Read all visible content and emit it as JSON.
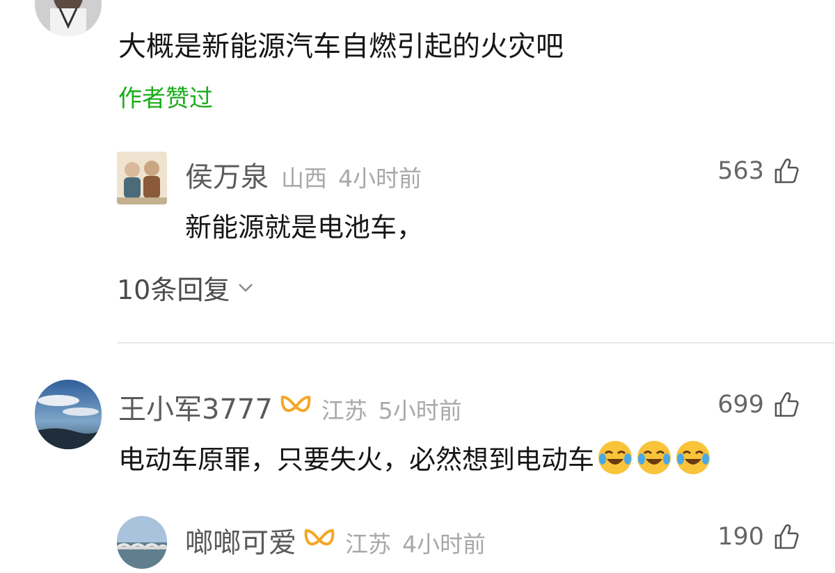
{
  "comments": [
    {
      "username": "",
      "text": "大概是新能源汽车自燃引起的火灾吧",
      "author_liked": "作者赞过"
    },
    {
      "username": "侯万泉",
      "location": "山西",
      "time": "4小时前",
      "likes": "563",
      "text": "新能源就是电池车，",
      "replies": "10条回复"
    },
    {
      "username": "王小军3777",
      "location": "江苏",
      "time": "5小时前",
      "likes": "699",
      "text": "电动车原罪，只要失火，必然想到电动车",
      "emojis": [
        "laugh-cry-emoji",
        "laugh-cry-emoji",
        "laugh-cry-emoji"
      ]
    },
    {
      "username": "啷啷可爱",
      "location": "江苏",
      "time": "4小时前",
      "likes": "190",
      "text": ""
    }
  ],
  "colors": {
    "author_liked": "#1aad19",
    "badge": "#f5a623",
    "divider": "#e8e8e8"
  }
}
